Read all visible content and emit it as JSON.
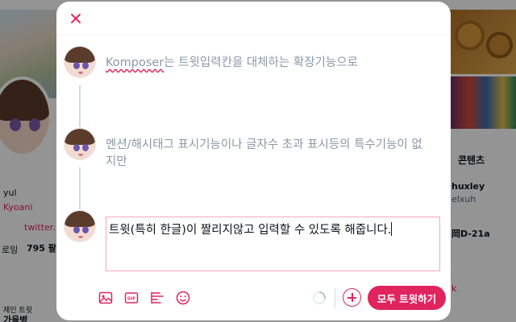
{
  "background": {
    "left_texts": [
      "yul",
      "Kyoani",
      "twitter.",
      "로잉",
      "795 팔",
      "제인 트윗",
      "가을병"
    ],
    "right_texts": [
      "콘텐츠",
      "huxley",
      "elxuh",
      "岡D-21a",
      "k"
    ]
  },
  "modal": {
    "close_label": "close",
    "tweets": [
      {
        "pre": "",
        "highlight": "Komposer",
        "post": "는 트윗입력칸을 대체하는 확장기능으로"
      },
      {
        "pre": "멘션/해시태그 표시기능이나 글자수 초과 표시등의 특수기능이 없지만",
        "highlight": "",
        "post": ""
      }
    ],
    "editor_text": "트윗(특히 한글)이 짤리지않고 입력할 수 있도록 해줍니다.",
    "toolbar": {
      "icons": [
        "image-icon",
        "gif-icon",
        "poll-icon",
        "emoji-icon"
      ],
      "tweet_all_label": "모두 트윗하기",
      "accent": "#e0245e"
    }
  }
}
